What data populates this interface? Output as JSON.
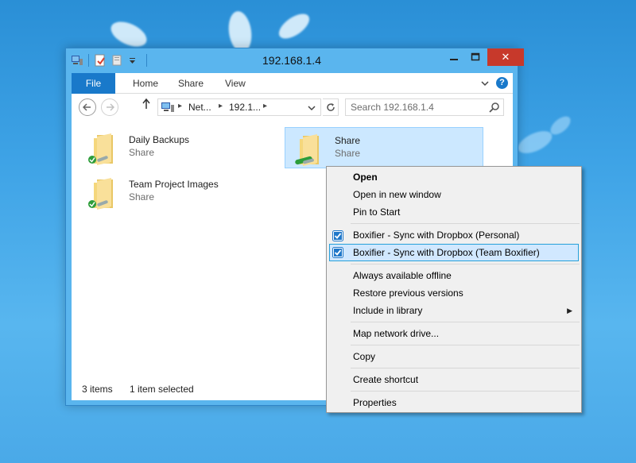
{
  "window": {
    "title": "192.168.1.4",
    "close_glyph": "✕",
    "minimize_glyph": "—",
    "maximize_glyph": "□"
  },
  "ribbon": {
    "tabs": [
      "File",
      "Home",
      "Share",
      "View"
    ],
    "help": "?"
  },
  "navigation": {
    "breadcrumb": [
      "Net...",
      "192.1..."
    ],
    "search_placeholder": "Search 192.168.1.4"
  },
  "items": [
    {
      "name": "Daily Backups",
      "type": "Share",
      "selected": false
    },
    {
      "name": "Share",
      "type": "Share",
      "selected": true
    },
    {
      "name": "Team Project Images",
      "type": "Share",
      "selected": false
    }
  ],
  "status": {
    "count": "3 items",
    "selection": "1 item selected"
  },
  "context_menu": {
    "items": [
      {
        "label": "Open",
        "bold": true
      },
      {
        "label": "Open in new window"
      },
      {
        "label": "Pin to Start"
      },
      {
        "label": "Boxifier - Sync with Dropbox (Personal)",
        "icon": "boxifier-check-icon"
      },
      {
        "label": "Boxifier - Sync with Dropbox (Team Boxifier)",
        "icon": "boxifier-check-icon",
        "highlighted": true
      },
      {
        "label": "Always available offline"
      },
      {
        "label": "Restore previous versions"
      },
      {
        "label": "Include in library",
        "submenu": true
      },
      {
        "label": "Map network drive..."
      },
      {
        "label": "Copy"
      },
      {
        "label": "Create shortcut"
      },
      {
        "label": "Properties"
      }
    ]
  },
  "colors": {
    "file_tab": "#1979ca",
    "selection_bg": "#cce8ff",
    "menu_highlight": "#d1e8ff",
    "close_button": "#c7392b"
  }
}
